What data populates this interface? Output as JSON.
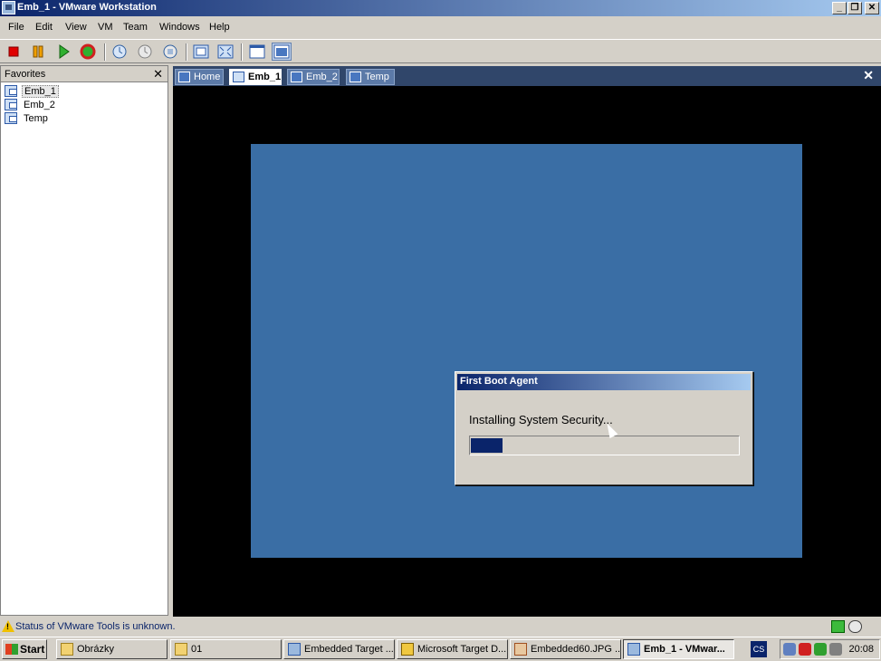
{
  "window": {
    "title": "Emb_1 - VMware Workstation",
    "buttons": {
      "minimize": "_",
      "restore": "❐",
      "close": "✕"
    }
  },
  "menu": [
    "File",
    "Edit",
    "View",
    "VM",
    "Team",
    "Windows",
    "Help"
  ],
  "toolbar_icons": [
    "power-off-icon",
    "pause-icon",
    "power-on-icon",
    "reset-icon",
    "snapshot-icon",
    "revert-snapshot-icon",
    "snapshot-manager-icon",
    "full-screen-icon",
    "quick-switch-icon",
    "summary-view-icon",
    "console-view-icon"
  ],
  "favorites": {
    "title": "Favorites",
    "close": "✕",
    "items": [
      "Emb_1",
      "Emb_2",
      "Temp"
    ]
  },
  "tabs": [
    "Home",
    "Emb_1",
    "Emb_2",
    "Temp"
  ],
  "tab_close": "✕",
  "guest": {
    "dialog_title": "First Boot Agent",
    "message": "Installing System Security...",
    "progress": 0.12
  },
  "status": {
    "text": "Status of VMware Tools is unknown."
  },
  "taskbar": {
    "start": "Start",
    "tasks": [
      "Obrázky",
      "01",
      "Embedded Target ...",
      "Microsoft Target D...",
      "Embedded60.JPG ...",
      "Emb_1 - VMwar..."
    ],
    "lang": "CS",
    "clock": "20:08"
  },
  "colors": {
    "title_start": "#0a246a",
    "title_end": "#a6caf0",
    "desktop": "#3a6ea5",
    "tabbar": "#30466a"
  }
}
